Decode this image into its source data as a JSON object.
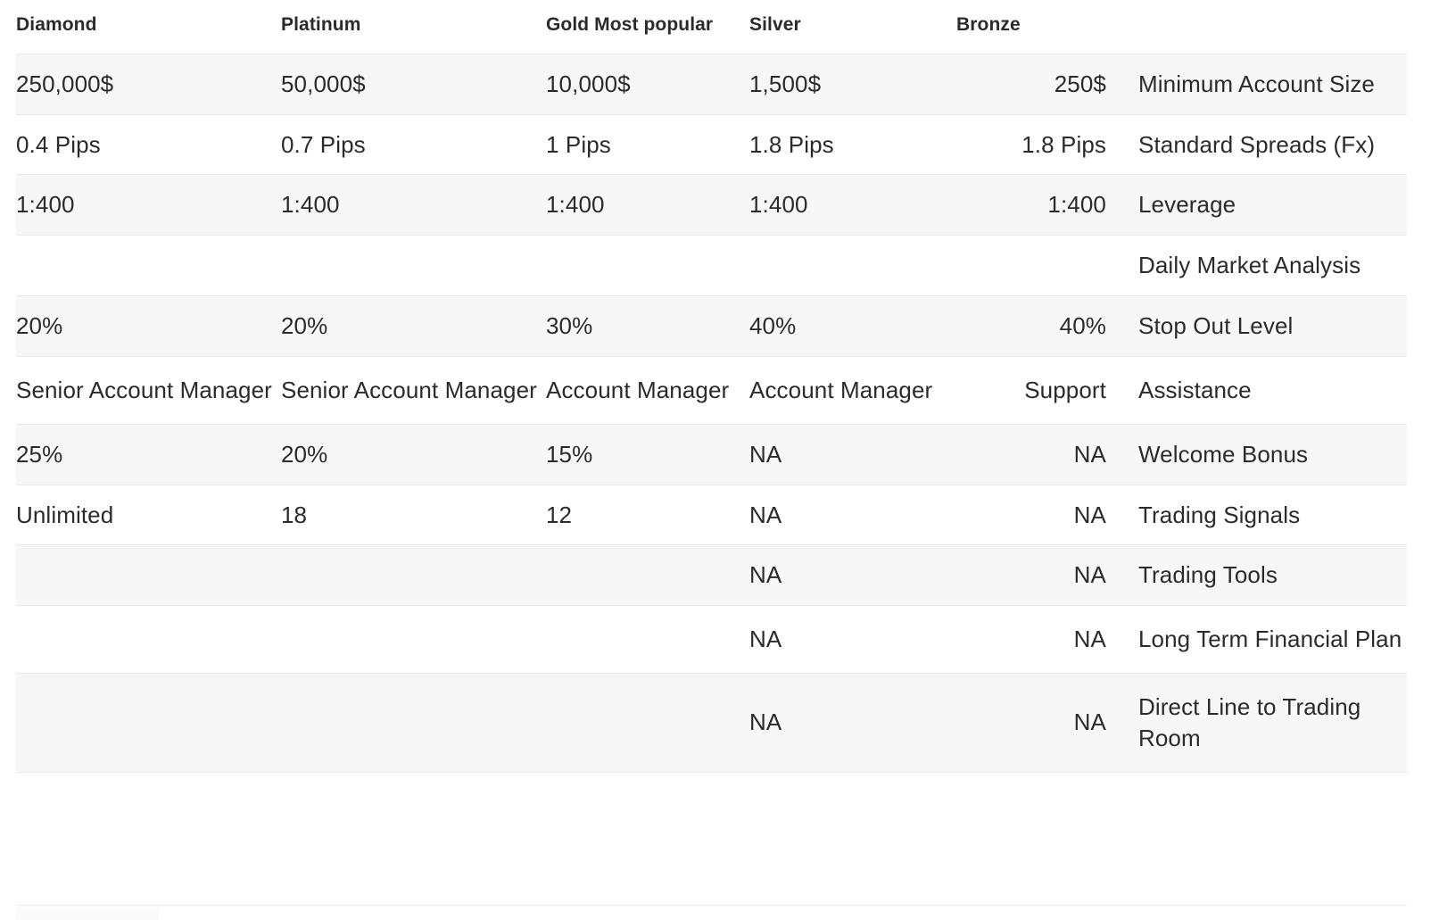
{
  "table": {
    "name": "account-type-comparison-table",
    "colors": {
      "text": "#2b2b2b",
      "stripe": "#f7f7f7",
      "background": "#ffffff",
      "border": "#eaeaea"
    },
    "columns": [
      {
        "key": "diamond",
        "label": "Diamond",
        "align": "left"
      },
      {
        "key": "platinum",
        "label": "Platinum",
        "align": "left"
      },
      {
        "key": "gold",
        "label": "Gold Most popular",
        "align": "left"
      },
      {
        "key": "silver",
        "label": "Silver",
        "align": "left"
      },
      {
        "key": "bronze",
        "label": "Bronze",
        "align": "right"
      },
      {
        "key": "feature",
        "label": "",
        "align": "left"
      }
    ],
    "rows": [
      {
        "feature": "Minimum Account Size",
        "diamond": "250,000$",
        "platinum": "50,000$",
        "gold": "10,000$",
        "silver": "1,500$",
        "bronze": "250$",
        "striped": true,
        "tall": false
      },
      {
        "feature": "Standard Spreads (Fx)",
        "diamond": "0.4 Pips",
        "platinum": "0.7 Pips",
        "gold": "1 Pips",
        "silver": "1.8 Pips",
        "bronze": "1.8 Pips",
        "striped": false,
        "tall": false
      },
      {
        "feature": "Leverage",
        "diamond": "1:400",
        "platinum": "1:400",
        "gold": "1:400",
        "silver": "1:400",
        "bronze": "1:400",
        "striped": true,
        "tall": false
      },
      {
        "feature": "Daily Market Analysis",
        "diamond": "",
        "platinum": "",
        "gold": "",
        "silver": "",
        "bronze": "",
        "striped": false,
        "tall": false
      },
      {
        "feature": "Stop Out Level",
        "diamond": "20%",
        "platinum": "20%",
        "gold": "30%",
        "silver": "40%",
        "bronze": "40%",
        "striped": true,
        "tall": false
      },
      {
        "feature": "Assistance",
        "diamond": "Senior Account Manager",
        "platinum": "Senior Account Manager",
        "gold": "Account Manager",
        "silver": "Account Manager",
        "bronze": "Support",
        "striped": false,
        "tall": true
      },
      {
        "feature": "Welcome Bonus",
        "diamond": "25%",
        "platinum": "20%",
        "gold": "15%",
        "silver": "NA",
        "bronze": "NA",
        "striped": true,
        "tall": false
      },
      {
        "feature": "Trading Signals",
        "diamond": "Unlimited",
        "platinum": "18",
        "gold": "12",
        "silver": "NA",
        "bronze": "NA",
        "striped": false,
        "tall": false
      },
      {
        "feature": "Trading Tools",
        "diamond": "",
        "platinum": "",
        "gold": "",
        "silver": "NA",
        "bronze": "NA",
        "striped": true,
        "tall": false
      },
      {
        "feature": "Long Term Financial Plan",
        "diamond": "",
        "platinum": "",
        "gold": "",
        "silver": "NA",
        "bronze": "NA",
        "striped": false,
        "tall": true
      },
      {
        "feature": "Direct Line to Trading Room",
        "diamond": "",
        "platinum": "",
        "gold": "",
        "silver": "NA",
        "bronze": "NA",
        "striped": true,
        "tall": true
      }
    ]
  }
}
